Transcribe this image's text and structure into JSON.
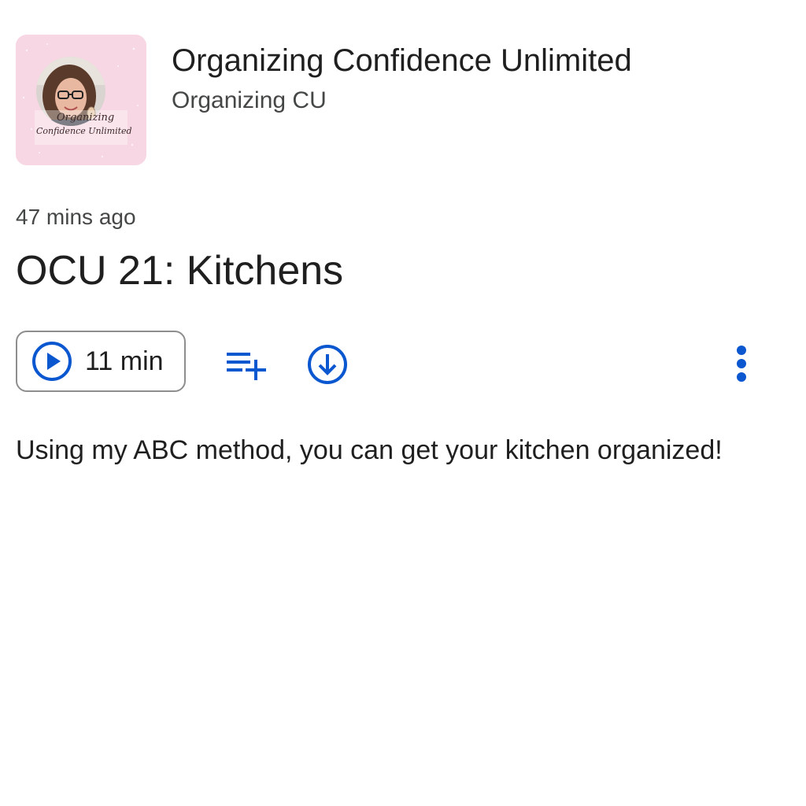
{
  "show": {
    "title": "Organizing Confidence Unlimited",
    "publisher": "Organizing CU",
    "artwork": {
      "text_line1": "Organizing",
      "text_line2": "Confidence Unlimited",
      "background_color": "#f8d7e4"
    }
  },
  "episode": {
    "date": "47 mins ago",
    "title": "OCU 21: Kitchens",
    "duration": "11 min",
    "description": "Using my ABC method, you can get your kitchen organized!"
  },
  "actions": {
    "play_icon": "play-circle-icon",
    "queue_icon": "playlist-add-icon",
    "download_icon": "download-circle-icon",
    "more_icon": "more-vert-icon"
  },
  "colors": {
    "accent": "#0b57d0",
    "text_primary": "#1f1f1f",
    "text_secondary": "#444746",
    "button_border": "#8e8e8e"
  }
}
